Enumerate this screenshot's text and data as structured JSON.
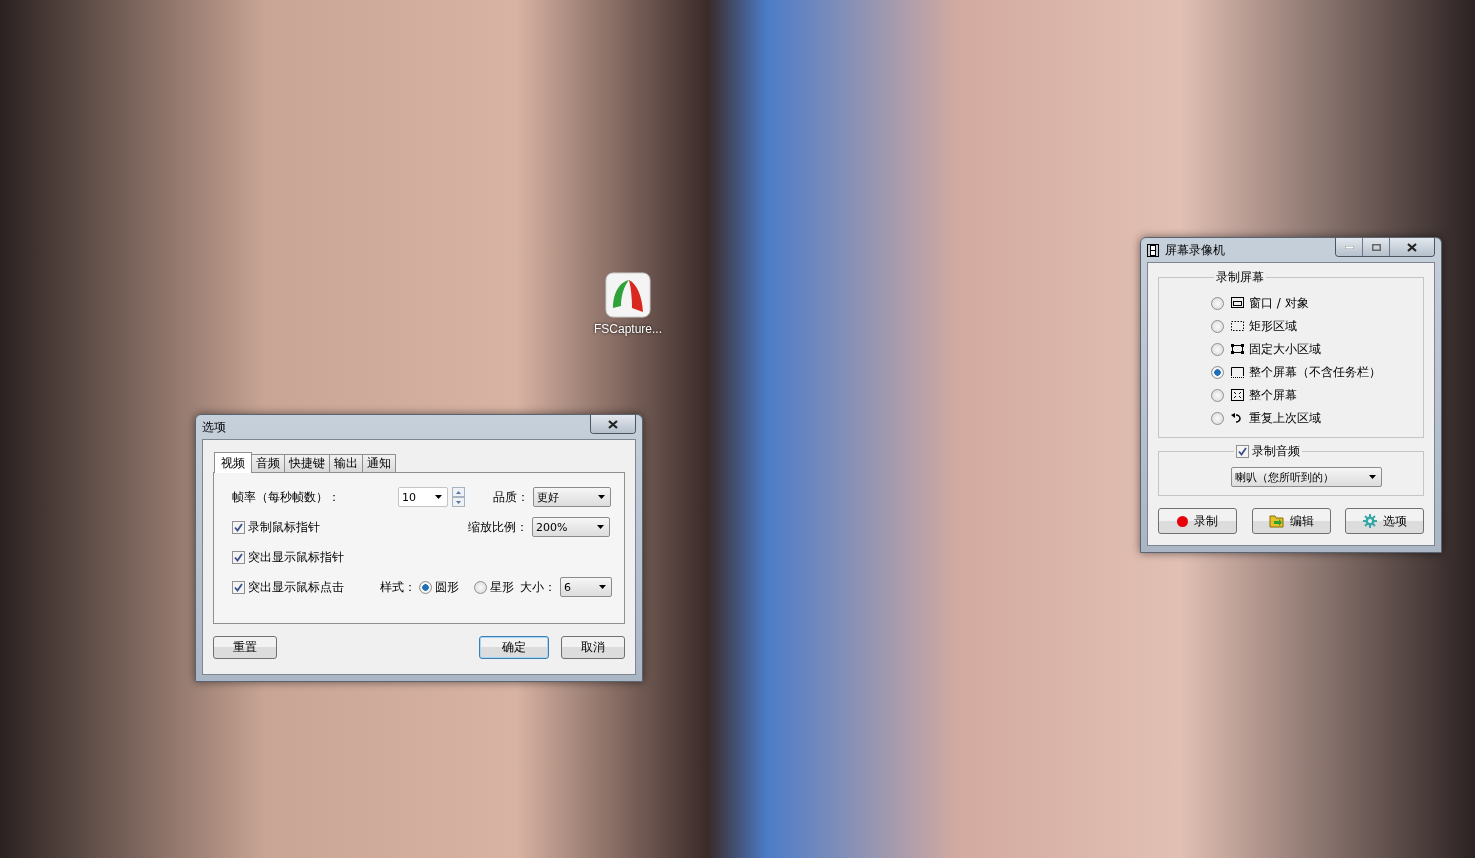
{
  "desktop": {
    "icons": [
      {
        "label": "FSCapture..."
      }
    ]
  },
  "options_dialog": {
    "title": "选项",
    "tabs": [
      {
        "label": "视频",
        "selected": true
      },
      {
        "label": "音频",
        "selected": false
      },
      {
        "label": "快捷键",
        "selected": false
      },
      {
        "label": "输出",
        "selected": false
      },
      {
        "label": "通知",
        "selected": false
      }
    ],
    "frame_rate": {
      "label": "帧率（每秒帧数）：",
      "value": "10"
    },
    "quality": {
      "label": "品质：",
      "value": "更好"
    },
    "scale": {
      "label": "缩放比例：",
      "value": "200%"
    },
    "checkboxes": [
      {
        "label": "录制鼠标指针",
        "checked": true
      },
      {
        "label": "突出显示鼠标指针",
        "checked": true
      },
      {
        "label": "突出显示鼠标点击",
        "checked": true
      }
    ],
    "style": {
      "label": "样式：",
      "options": [
        {
          "label": "圆形",
          "selected": true
        },
        {
          "label": "星形",
          "selected": false
        }
      ]
    },
    "size": {
      "label": "大小：",
      "value": "6"
    },
    "buttons": [
      {
        "label": "重置",
        "default": false
      },
      {
        "label": "确定",
        "default": true
      },
      {
        "label": "取消",
        "default": false
      }
    ]
  },
  "recorder": {
    "title": "屏幕录像机",
    "group_title": "录制屏幕",
    "sources": [
      {
        "kind": "window",
        "label": "窗口 / 对象",
        "selected": false
      },
      {
        "kind": "rect",
        "label": "矩形区域",
        "selected": false
      },
      {
        "kind": "fixed",
        "label": "固定大小区域",
        "selected": false
      },
      {
        "kind": "screen-no-taskbar",
        "label": "整个屏幕（不含任务栏）",
        "selected": true
      },
      {
        "kind": "screen",
        "label": "整个屏幕",
        "selected": false
      },
      {
        "kind": "repeat",
        "label": "重复上次区域",
        "selected": false
      }
    ],
    "audio": {
      "label": "录制音频",
      "checked": true,
      "device": "喇叭（您所听到的）"
    },
    "buttons": [
      {
        "kind": "record",
        "label": "录制"
      },
      {
        "kind": "edit",
        "label": "编辑"
      },
      {
        "kind": "options",
        "label": "选项"
      }
    ]
  }
}
